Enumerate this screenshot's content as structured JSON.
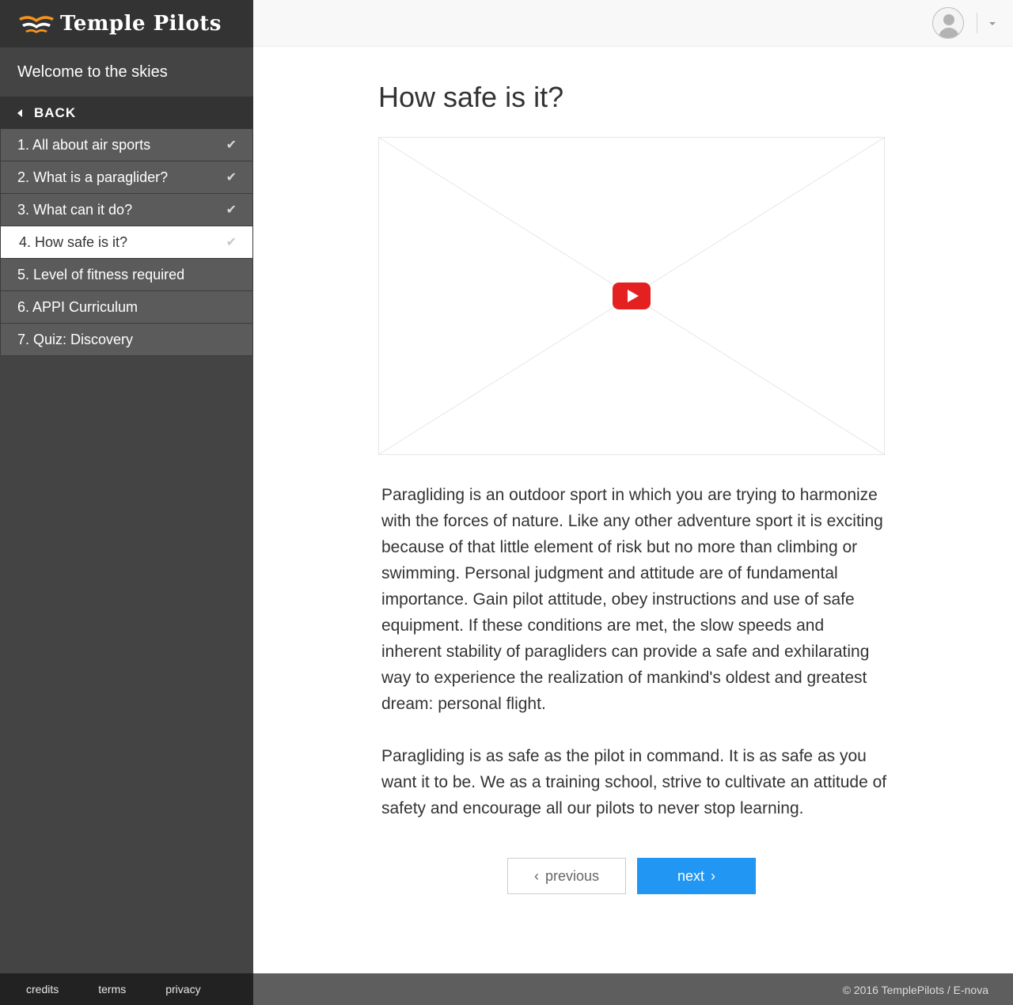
{
  "brand": {
    "name": "Temple Pilots",
    "colors": {
      "logo_orange": "#f7941d",
      "accent": "#2196f3"
    }
  },
  "sidebar": {
    "course_title": "Welcome to the skies",
    "back_label": "BACK",
    "lessons": [
      {
        "label": "1. All about air sports",
        "completed": true,
        "active": false
      },
      {
        "label": "2. What is a paraglider?",
        "completed": true,
        "active": false
      },
      {
        "label": "3. What can it do?",
        "completed": true,
        "active": false
      },
      {
        "label": "4. How safe is it?",
        "completed": true,
        "active": true
      },
      {
        "label": "5. Level of fitness required",
        "completed": false,
        "active": false
      },
      {
        "label": "6. APPI Curriculum",
        "completed": false,
        "active": false
      },
      {
        "label": "7. Quiz: Discovery",
        "completed": false,
        "active": false
      }
    ],
    "check_icon": "✔",
    "footer_links": {
      "credits": "credits",
      "terms": "terms",
      "privacy": "privacy"
    }
  },
  "topbar": {
    "avatar_icon": "user-avatar-icon",
    "menu_icon": "chevron-down-icon"
  },
  "main": {
    "title": "How safe is it?",
    "video": {
      "icon": "youtube-play-icon"
    },
    "paragraphs": [
      "Paragliding is an outdoor sport in which you are trying to harmonize with the forces of nature. Like any other adventure sport it is exciting because of that little element of risk but no more than climbing or swimming. Personal judgment and attitude are of fundamental importance. Gain pilot attitude, obey instructions and use of safe equipment. If these conditions are met, the slow speeds and inherent stability of paragliders can provide a safe and exhilarating way to experience the realization of mankind's oldest and greatest dream: personal flight.",
      "Paragliding is as safe as the pilot in command. It is as safe as you want it to be. We as a training school, strive to cultivate an attitude of safety and encourage all our pilots to never stop learning."
    ],
    "prev_label": "previous",
    "next_label": "next",
    "prev_chevron": "‹",
    "next_chevron": "›"
  },
  "footer": {
    "copyright": "© 2016 TemplePilots / E-nova"
  }
}
